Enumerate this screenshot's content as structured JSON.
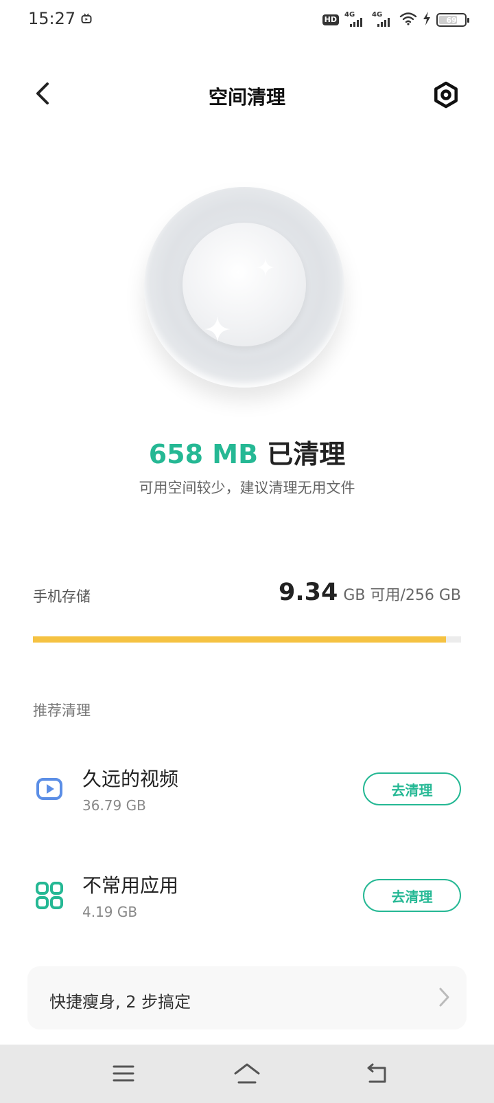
{
  "status_bar": {
    "time": "15:27",
    "hd_badge": "HD",
    "signal_1_label": "4G",
    "signal_2_label": "4G",
    "battery": "69"
  },
  "header": {
    "title": "空间清理",
    "back_icon": "chevron-left-icon",
    "settings_icon": "gear-hex-icon"
  },
  "result": {
    "amount": "658 MB",
    "label": " 已清理",
    "hint": "可用空间较少，建议清理无用文件"
  },
  "storage": {
    "label": "手机存储",
    "free": "9.34",
    "unit_total": "GB 可用/256 GB",
    "used_fraction": 0.964
  },
  "recommend": {
    "title": "推荐清理",
    "items": [
      {
        "title": "久远的视频",
        "size": "36.79 GB",
        "button": "去清理",
        "icon": "video-icon"
      },
      {
        "title": "不常用应用",
        "size": "4.19 GB",
        "button": "去清理",
        "icon": "apps-grid-icon"
      }
    ]
  },
  "quick": {
    "text": "快捷瘦身, 2 步搞定"
  },
  "colors": {
    "accent": "#25b894",
    "storage_bar": "#f5c242",
    "video_icon": "#5b8ee6"
  }
}
